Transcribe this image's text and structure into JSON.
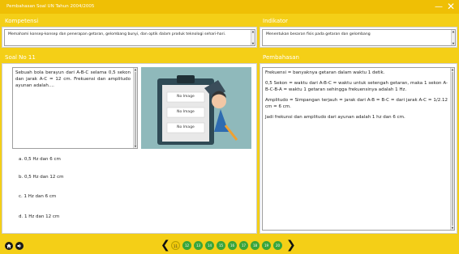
{
  "window": {
    "title": "Pembahasan Soal UN Tahun 2004/2005",
    "minimize": "—",
    "close": "✕"
  },
  "kompetensi": {
    "label": "Kompetensi",
    "text": "Memahami konsep-konsep dan penerapan getaran, gelombang bunyi, dan optik dalam produk teknologi sehari-hari."
  },
  "indikator": {
    "label": "Indikator",
    "text": "Menentukan besaran fisis pada getaran dan gelombang"
  },
  "soal": {
    "label": "Soal No 11",
    "text": "Sebuah bola berayun dari A-B-C selama 0,5 sekon dan jarak A-C = 12 cm. Frekuensi dan amplitudo ayunan adalah....",
    "image_placeholders": [
      "No Image",
      "No Image",
      "No Image"
    ],
    "options": [
      "a. 0,5 Hz dan 6 cm",
      "b. 0,5 Hz dan 12 cm",
      "c. 1 Hz dan 6 cm",
      "d. 1 Hz dan 12 cm"
    ]
  },
  "pembahasan": {
    "label": "Pembahasan",
    "paragraphs": [
      "Frekuensi = banyaknya getaran dalam waktu 1 detik.",
      "0,5 Sekon = waktu dari A-B-C = waktu untuk setengah getaran, maka 1 sekon A-B-C-B-A = waktu 1 getaran sehingga frekuensinya adalah 1 Hz.",
      "Amplitudo = Simpangan terjauh = jarak dari A-B = B-C = dari jarak A-C = 1/2.12 cm = 6 cm.",
      "Jadi frekunsi dan amplitudo dari ayunan adalah 1 hz dan 6 cm."
    ]
  },
  "footer": {
    "prev": "❮",
    "next": "❯",
    "pages": [
      "11",
      "12",
      "13",
      "14",
      "15",
      "16",
      "17",
      "18",
      "19",
      "20"
    ],
    "current_page": "11"
  },
  "colors": {
    "frame": "#f4cf17",
    "titlebar": "#efbf05",
    "page_dot": "#3aa53a",
    "page_dot_active": "#f0c809"
  }
}
